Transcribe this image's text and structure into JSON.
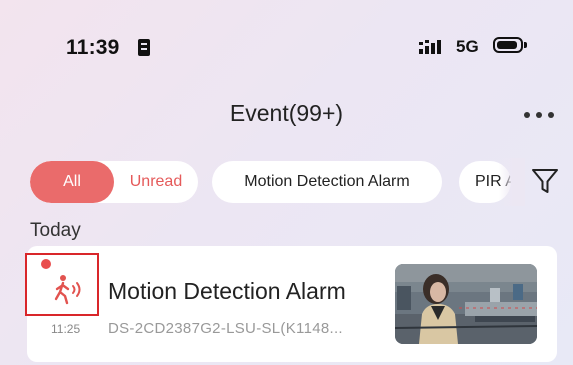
{
  "status_bar": {
    "time": "11:39",
    "network": "5G",
    "icons": [
      "sim-card-icon",
      "signal-icon",
      "battery-icon"
    ]
  },
  "header": {
    "title": "Event(99+)",
    "more_icon": "more-dots-icon"
  },
  "filters": {
    "all_label": "All",
    "unread_label": "Unread",
    "chips": [
      "Motion Detection Alarm",
      "PIR A"
    ],
    "filter_icon": "filter-funnel-icon",
    "accent_color": "#ea6b6b"
  },
  "events": {
    "section_label": "Today",
    "items": [
      {
        "title": "Motion Detection Alarm",
        "time": "11:25",
        "device": "DS-2CD2387G2-LSU-SL(K1148...",
        "icon": "motion-person-icon",
        "unread": true,
        "thumbnail": "camera-snapshot"
      }
    ]
  }
}
